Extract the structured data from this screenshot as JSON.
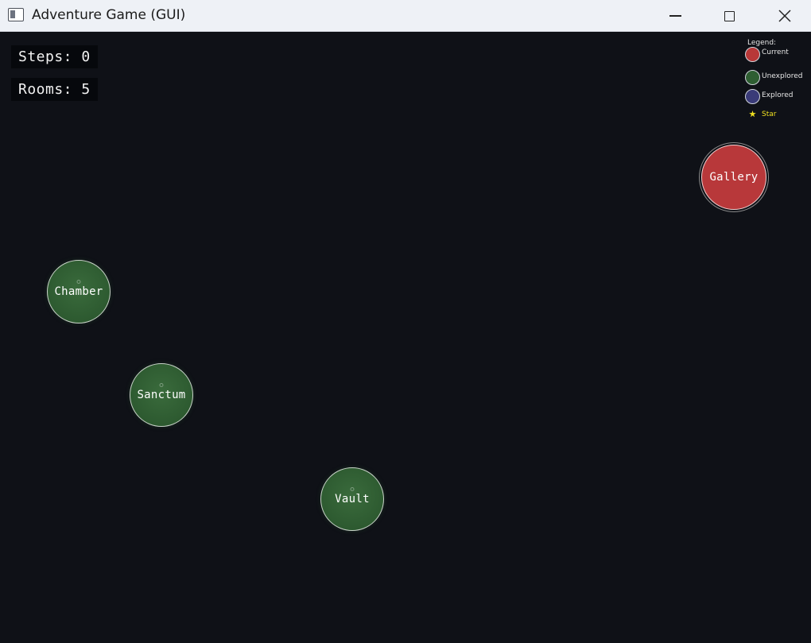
{
  "window": {
    "title": "Adventure Game (GUI)",
    "controls": [
      "minimize",
      "maximize",
      "close"
    ]
  },
  "hud": {
    "steps_text": "Steps: 0",
    "rooms_text": "Rooms: 5"
  },
  "legend": {
    "title": "Legend:",
    "items": [
      {
        "label": "Current",
        "color": "#b83838"
      },
      {
        "label": "Unexplored",
        "color": "#2e5e32"
      },
      {
        "label": "Explored",
        "color": "#3a3b78"
      },
      {
        "label": "Star",
        "color": "#f0e020"
      }
    ]
  },
  "rooms": [
    {
      "name": "Gallery",
      "state": "current"
    },
    {
      "name": "Chamber",
      "state": "unexplored"
    },
    {
      "name": "Sanctum",
      "state": "unexplored"
    },
    {
      "name": "Vault",
      "state": "unexplored"
    }
  ],
  "colors": {
    "background": "#0f1117",
    "current": "#b83838",
    "unexplored": "#2e5e32",
    "explored": "#3a3b78",
    "star": "#f0e020"
  }
}
